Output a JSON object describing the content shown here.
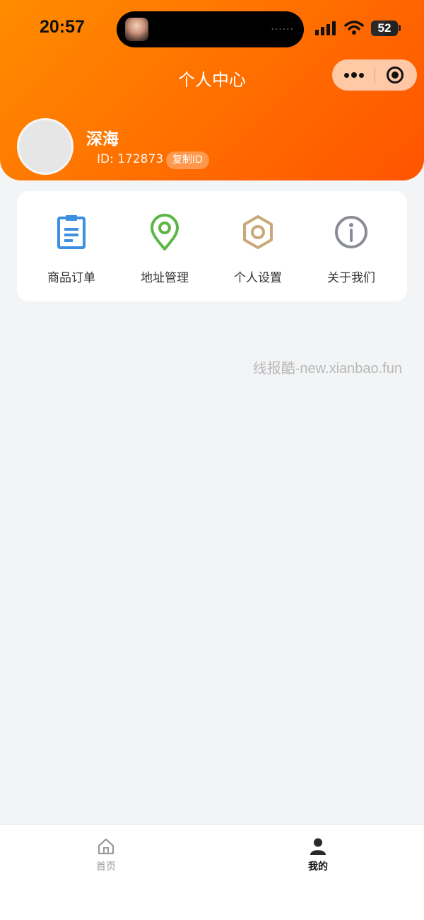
{
  "status_bar": {
    "time": "20:57",
    "battery": "52",
    "battery_level": 0.52,
    "island_dots": "......"
  },
  "header": {
    "title": "个人中心",
    "gradient": [
      "#ff8c00",
      "#ff5400"
    ]
  },
  "profile": {
    "name": "深海",
    "id_text": "ID: 172873",
    "copy_button": "复制ID"
  },
  "menu": [
    {
      "label": "商品订单",
      "icon": "clipboard-icon",
      "color": "#3d8fe0"
    },
    {
      "label": "地址管理",
      "icon": "location-pin-icon",
      "color": "#5bb645"
    },
    {
      "label": "个人设置",
      "icon": "hexagon-settings-icon",
      "color": "#c9a978"
    },
    {
      "label": "关于我们",
      "icon": "info-icon",
      "color": "#8a8d94"
    }
  ],
  "watermark": "线报酷-new.xianbao.fun",
  "tabbar": {
    "tabs": [
      {
        "label": "首页",
        "icon": "home-icon",
        "active": false
      },
      {
        "label": "我的",
        "icon": "person-icon",
        "active": true
      }
    ]
  }
}
